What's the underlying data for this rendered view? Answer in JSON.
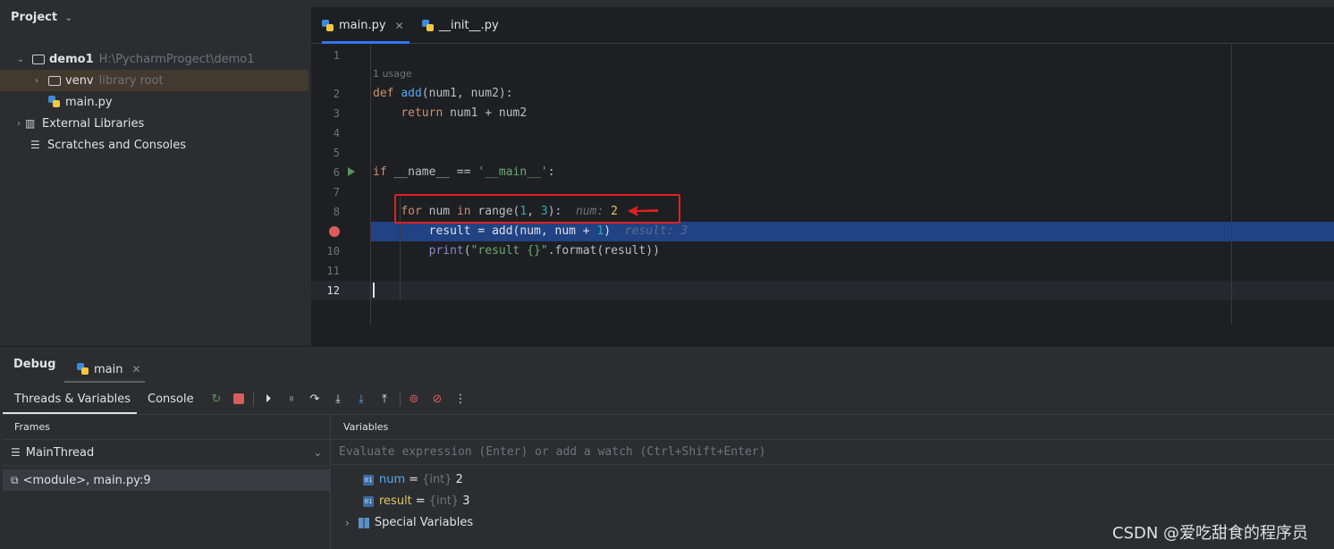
{
  "project": {
    "header": "Project",
    "tree": [
      {
        "label": "demo1",
        "path": "H:\\PycharmProgect\\demo1"
      },
      {
        "label": "venv",
        "note": "library root"
      },
      {
        "label": "main.py"
      },
      {
        "label": "External Libraries"
      },
      {
        "label": "Scratches and Consoles"
      }
    ]
  },
  "editor": {
    "tabs": [
      {
        "label": "main.py"
      },
      {
        "label": "__init__.py"
      }
    ],
    "usage_hint": "1 usage",
    "line_numbers": [
      "1",
      "2",
      "3",
      "4",
      "5",
      "6",
      "7",
      "8",
      "9",
      "10",
      "11",
      "12"
    ],
    "code": {
      "l2_kw": "def",
      "l2_fn": "add",
      "l2_rest": "(num1, num2):",
      "l3_kw": "return",
      "l3_rest": " num1 + num2",
      "l6_kw": "if",
      "l6_mid": " __name__ == ",
      "l6_str": "'__main__'",
      "l6_end": ":",
      "l8_for": "for",
      "l8_mid": " num ",
      "l8_in": "in",
      "l8_range": " range(",
      "l8_n1": "1",
      "l8_comma": ", ",
      "l8_n2": "3",
      "l8_end": "):",
      "l8_hint_name": "num: ",
      "l8_hint_val": "2",
      "l9_a": "result = add(num, num + ",
      "l9_n": "1",
      "l9_b": ")",
      "l9_hint": "result: 3",
      "l10_fn": "print",
      "l10_a": "(",
      "l10_str": "\"result {}\"",
      "l10_b": ".format(result))"
    }
  },
  "debug": {
    "title": "Debug",
    "session_tab": "main",
    "subtabs": {
      "threads": "Threads & Variables",
      "console": "Console"
    },
    "frames_label": "Frames",
    "thread": "MainThread",
    "frame": "<module>, main.py:9",
    "variables_label": "Variables",
    "eval_placeholder": "Evaluate expression (Enter) or add a watch (Ctrl+Shift+Enter)",
    "variables": [
      {
        "name": "num",
        "type": "{int}",
        "value": "2"
      },
      {
        "name": "result",
        "type": "{int}",
        "value": "3"
      },
      {
        "name": "Special Variables"
      }
    ]
  },
  "watermark": "CSDN @爱吃甜食的程序员",
  "colors": {
    "accent": "#3574f0",
    "exec_line": "#214283",
    "breakpoint": "#db5c5c",
    "annotation": "#e02020"
  }
}
